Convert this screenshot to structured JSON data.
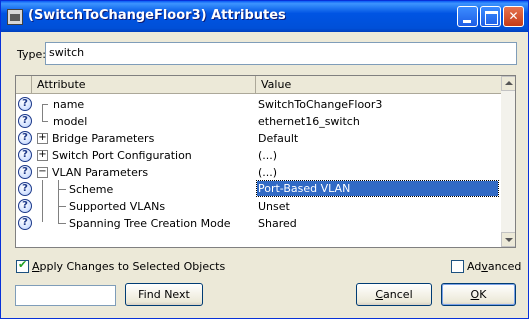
{
  "window": {
    "title": "(SwitchToChangeFloor3) Attributes",
    "buttons": {
      "minimize": "minimize",
      "maximize": "maximize",
      "close": "✕"
    }
  },
  "type_field": {
    "label": "Type:",
    "value": "switch"
  },
  "grid": {
    "columns": {
      "attribute": "Attribute",
      "value": "Value"
    },
    "rows": [
      {
        "name": "name",
        "value": "SwitchToChangeFloor3",
        "expander": ""
      },
      {
        "name": "model",
        "value": "ethernet16_switch",
        "expander": ""
      },
      {
        "name": "Bridge Parameters",
        "value": "Default",
        "expander": "+"
      },
      {
        "name": "Switch Port Configuration",
        "value": "(...)",
        "expander": "+"
      },
      {
        "name": "VLAN Parameters",
        "value": "(...)",
        "expander": "−"
      },
      {
        "name": "Scheme",
        "value": "Port-Based VLAN",
        "expander": "",
        "selected": true
      },
      {
        "name": "Supported VLANs",
        "value": "Unset",
        "expander": ""
      },
      {
        "name": "Spanning Tree Creation Mode",
        "value": "Shared",
        "expander": ""
      }
    ]
  },
  "apply_changes": {
    "label_u": "A",
    "label_rest": "pply Changes to Selected Objects",
    "checked": true
  },
  "advanced": {
    "label_pre": "Ad",
    "label_u": "v",
    "label_rest": "anced",
    "checked": false
  },
  "search": {
    "value": ""
  },
  "buttons": {
    "find_next": "Find Next",
    "cancel_u": "C",
    "cancel_rest": "ancel",
    "ok_u": "O",
    "ok_rest": "K"
  },
  "colors": {
    "title_bar": "#0054e3",
    "selection": "#316ac5",
    "background": "#ece9d8"
  }
}
